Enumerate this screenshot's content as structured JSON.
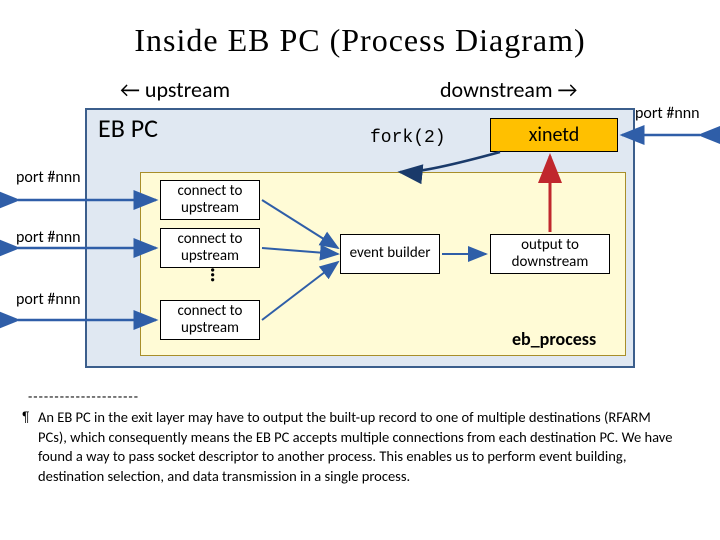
{
  "title": "Inside EB PC (Process Diagram)",
  "direction": {
    "upstream": "← upstream",
    "downstream": "downstream →"
  },
  "outer_box_label": "EB PC",
  "fork_label": "fork(2)",
  "xinetd_label": "xinetd",
  "port_labels": {
    "right": "port #nnn",
    "left_1": "port #nnn",
    "left_2": "port #nnn",
    "left_3": "port #nnn"
  },
  "inner": {
    "connect_1": "connect to upstream",
    "connect_2": "connect to upstream",
    "dots": "…",
    "connect_3": "connect to upstream",
    "event_builder": "event builder",
    "output_downstream": "output to downstream",
    "process_label": "eb_process"
  },
  "footnote": {
    "dashes": "---------------------",
    "bullet": "¶",
    "text": "An EB PC in the exit layer may have to output the built-up record to one of multiple destinations (RFARM PCs), which consequently means the EB PC accepts multiple connections from each destination PC.  We have found a way to pass socket descriptor to another process.  This enables us to perform event building, destination selection, and data transmission in a single process."
  },
  "colors": {
    "outer_fill": "#e0e8f2",
    "outer_border": "#3b5e8c",
    "xinetd_fill": "#ffc000",
    "inner_fill": "#fffbd6",
    "inner_border": "#a88e2a",
    "arrow_blue": "#2f5ea8",
    "arrow_red": "#c0272d"
  }
}
